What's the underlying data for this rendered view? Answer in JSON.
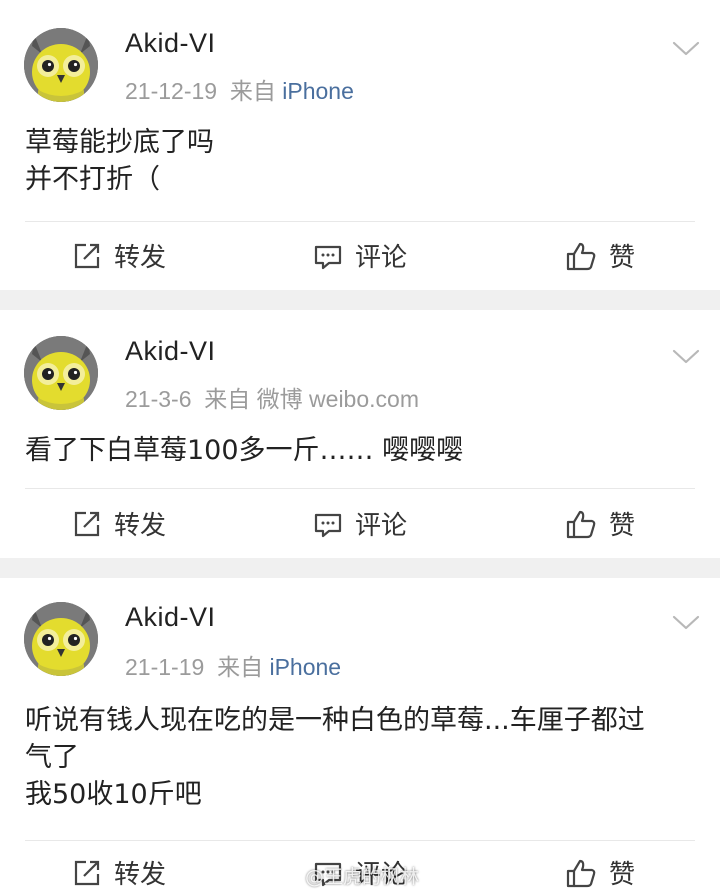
{
  "posts": [
    {
      "username": "Akid-VI",
      "date": "21-12-19",
      "from_label": "来自",
      "source": "iPhone",
      "content": "草莓能抄底了吗\n并不打折（",
      "actions": {
        "repost": "转发",
        "comment": "评论",
        "like": "赞"
      }
    },
    {
      "username": "Akid-VI",
      "date": "21-3-6",
      "from_label": "来自",
      "source": "微博 weibo.com",
      "content": "看了下白草莓100多一斤…… 嘤嘤嘤",
      "actions": {
        "repost": "转发",
        "comment": "评论",
        "like": "赞"
      }
    },
    {
      "username": "Akid-VI",
      "date": "21-1-19",
      "from_label": "来自",
      "source": "iPhone",
      "content": "听说有钱人现在吃的是一种白色的草莓...车厘子都过\n气了\n我50收10斤吧",
      "actions": {
        "repost": "转发",
        "comment": "评论",
        "like": "赞"
      }
    }
  ],
  "colors": {
    "source_iphone": "#4a6f9e",
    "meta_gray": "#9b9b9b",
    "separator": "#f0f0f0",
    "avatar_owl_yellow": "#e8e23a"
  },
  "icons": {
    "avatar": "owl-avatar-icon",
    "more": "chevron-down-icon",
    "repost": "repost-icon",
    "comment": "comment-icon",
    "like": "thumbs-up-icon"
  },
  "watermark": "@王虎的枫林"
}
